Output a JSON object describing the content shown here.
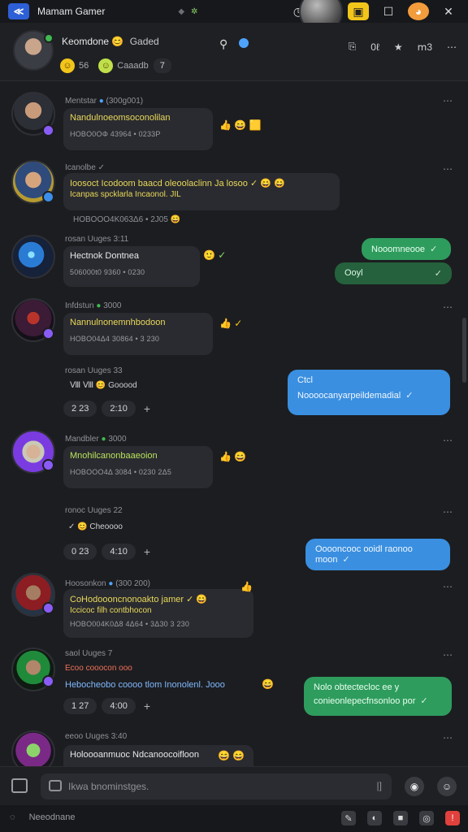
{
  "titlebar": {
    "app_title": "Mamam Gamer",
    "mini": [
      "◆",
      "✲"
    ],
    "icons": [
      "history-icon",
      "orange-app-icon",
      "yellow-app-icon",
      "profile-avatar",
      "window-icon",
      "orb-icon",
      "close-icon"
    ]
  },
  "channel": {
    "name": "Keomdone",
    "name_emoji": "😊",
    "subtitle": "Gaded",
    "count1": "56",
    "pill": "Caaadb",
    "count2": "7",
    "right_labels": [
      "0ℓ",
      "ⅿ3"
    ]
  },
  "messages": [
    {
      "author": "Mentstar",
      "author_meta": "(300g001)",
      "text": "Nandulnoeomsoconolilan",
      "stamp": "HOBO0ΟΦ 43964 • 0233P",
      "side": "👍 😄 🟨"
    },
    {
      "author": "Icanolbe",
      "author_meta": "✓",
      "text": "Ioosoct Icodoom baacd oleoolaclinn Ja losoo ✓ 😄 😄",
      "text2": "Icanpas spcklarla Incaonol. JIL",
      "stamp": "HOBOOO4K063Δ6 • 2J05 😄"
    },
    {
      "author": "rosan Uuges 3:11",
      "author_meta": "",
      "text": "Hectnok Dontnea",
      "stamp": "506000t0 9360 • 0230",
      "side": "🙂 ✓"
    },
    {
      "author": "Infdstun",
      "author_meta": "3000",
      "text": "Nannulnonemnhbodoon",
      "stamp": "HOBO04Δ4 30864 • 3 230",
      "side": "👍 ✓"
    },
    {
      "author": "Mandbler",
      "author_meta": "3000",
      "text": "Mnohilcanonbaaeoion",
      "stamp": "HOBOOO4Δ 3084 • 0230  2Δ5",
      "side": "👍 😄"
    },
    {
      "author": "Hoosonkon",
      "author_meta": "(300 200)",
      "text": "CoHodoooncnonoakto jamer ✓ 😄",
      "text2": "Iccicoc filh contbhocon",
      "stamp": "HOBO004K0Δ8 4Δ64 • 3Δ30  3 230"
    },
    {
      "author": "saol Uuges 7",
      "author_meta": "",
      "text_top": "Ecoo cooocon ooo",
      "text": "Hebocheobo coooo tlom Inonolenl. Jooo",
      "side": "😄"
    },
    {
      "author": "eeoo Uuges 3:40",
      "author_meta": "",
      "text": "Holoooanmuoc Ndcanoocoifloon",
      "side": "😄 😄"
    }
  ],
  "reactions": [
    {
      "date": "rosan Uuges 33",
      "tags": "Ⅷ Ⅷ 😊 Gooood",
      "count": "2 23",
      "time": "2:10"
    },
    {
      "date": "ronoc Uuges 22",
      "tags": "✓ 😊 Cheoooo",
      "count": "0 23",
      "time": "4:10"
    },
    {
      "date": "",
      "tags": "",
      "count": "1 27",
      "time": "4:00"
    }
  ],
  "outgoing": [
    {
      "text": "Nooomneooe",
      "style": "green"
    },
    {
      "text": "Ooyl",
      "style": "dkgreen"
    },
    {
      "text": "Ctcl",
      "style": "blue"
    },
    {
      "text": "Noooocanyarpeildemadial",
      "style": "blue"
    },
    {
      "text": "Ooooncooc ooidl raonoo moon",
      "style": "blue"
    },
    {
      "text": "Nolo   obtectecloc ee y",
      "style": "green"
    },
    {
      "text": "conieonlepecfnsonloo por",
      "style": "green"
    }
  ],
  "composer": {
    "placeholder": "Ikwa bnominstges."
  },
  "statusbar": {
    "label": "Neeodnane",
    "icons": [
      "compose-icon",
      "theme-icon",
      "stop-icon",
      "chat-icon",
      "alert-icon"
    ]
  }
}
